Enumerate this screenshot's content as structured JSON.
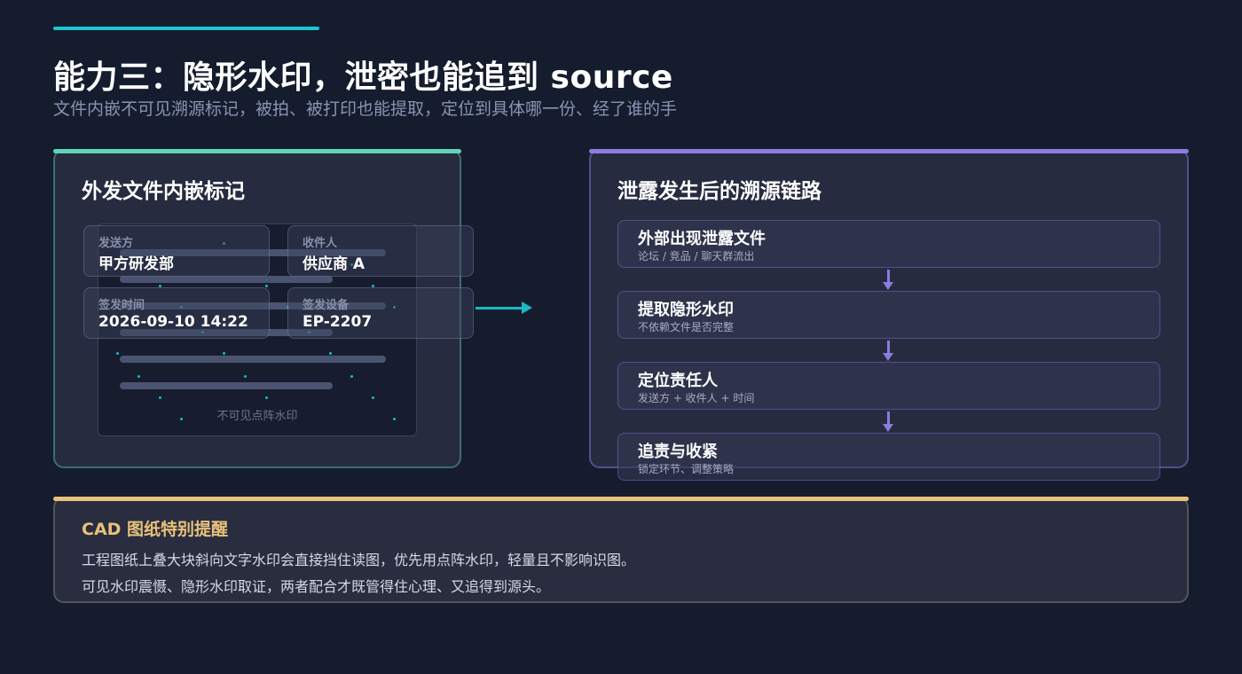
{
  "header": {
    "title": "能力三：隐形水印，泄密也能追到 source",
    "subtitle": "文件内嵌不可见溯源标记，被拍、被打印也能提取，定位到具体哪一份、经了谁的手"
  },
  "left_card": {
    "title": "外发文件内嵌标记",
    "doc_caption": "不可见点阵水印",
    "fields": [
      {
        "label": "发送方",
        "value": "甲方研发部"
      },
      {
        "label": "收件人",
        "value": "供应商 A"
      },
      {
        "label": "签发时间",
        "value": "2026-09-10 14:22"
      },
      {
        "label": "签发设备",
        "value": "EP-2207"
      }
    ]
  },
  "right_card": {
    "title": "泄露发生后的溯源链路",
    "steps": [
      {
        "title": "外部出现泄露文件",
        "desc": "论坛 / 竞品 / 聊天群流出"
      },
      {
        "title": "提取隐形水印",
        "desc": "不依赖文件是否完整"
      },
      {
        "title": "定位责任人",
        "desc": "发送方 + 收件人 + 时间"
      },
      {
        "title": "追责与收紧",
        "desc": "锁定环节、调整策略"
      }
    ]
  },
  "cad_note": {
    "title": "CAD 图纸特别提醒",
    "lines": [
      "工程图纸上叠大块斜向文字水印会直接挡住读图，优先用点阵水印，轻量且不影响识图。",
      "可见水印震慑、隐形水印取证，两者配合才既管得住心理、又追得到源头。"
    ]
  },
  "colors": {
    "background": "#141c2e",
    "teal_accent": "#1cc6d1",
    "green_accent": "#5fd4bb",
    "purple_accent": "#8a7ce0",
    "gold_accent": "#e8c27a"
  }
}
